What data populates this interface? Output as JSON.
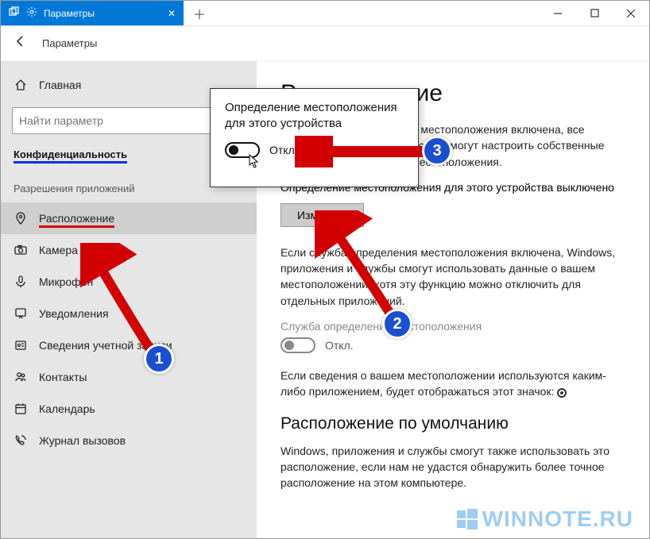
{
  "titlebar": {
    "tab_label": "Параметры"
  },
  "toolbar": {
    "title": "Параметры"
  },
  "sidebar": {
    "home": "Главная",
    "search_placeholder": "Найти параметр",
    "category": "Конфиденциальность",
    "section": "Разрешения приложений",
    "items": [
      {
        "icon": "location",
        "label": "Расположение",
        "active": true,
        "underline": true
      },
      {
        "icon": "camera",
        "label": "Камера"
      },
      {
        "icon": "mic",
        "label": "Микрофон"
      },
      {
        "icon": "notif",
        "label": "Уведомления"
      },
      {
        "icon": "account",
        "label": "Сведения учетной записи"
      },
      {
        "icon": "contacts",
        "label": "Контакты"
      },
      {
        "icon": "calendar",
        "label": "Календарь"
      },
      {
        "icon": "calls",
        "label": "Журнал вызовов"
      }
    ]
  },
  "content": {
    "h1": "Расположение",
    "p1": "Если служба определения местоположения включена, все пользователи этого устройства смогут настроить собственные параметры определения местоположения.",
    "status": "Определение местоположения для этого устройства выключено",
    "change_btn": "Изменить",
    "p2": "Если служба определения местоположения включена, Windows, приложения и службы смогут использовать данные о вашем местоположении, хотя эту функцию можно отключить для отдельных приложений.",
    "service_label": "Служба определения местоположения",
    "service_state": "Откл.",
    "p3_a": "Если сведения о вашем местоположении используются каким-либо приложением, будет отображаться этот значок: ",
    "h2": "Расположение по умолчанию",
    "p4": "Windows, приложения и службы смогут также использовать это расположение, если нам не удастся обнаружить более точное расположение на этом компьютере."
  },
  "popup": {
    "title": "Определение местоположения для этого устройства",
    "state": "Откл."
  },
  "badges": {
    "b1": "1",
    "b2": "2",
    "b3": "3"
  },
  "watermark": "WINNOTE.RU"
}
